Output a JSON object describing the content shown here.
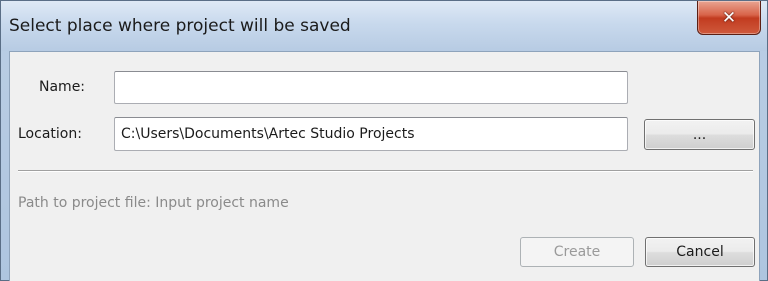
{
  "window": {
    "title": "Select place where project will be saved",
    "close_glyph": "✕"
  },
  "form": {
    "name_label": "Name:",
    "name_value": "",
    "location_label": "Location:",
    "location_value": "C:\\Users\\Documents\\Artec Studio Projects",
    "browse_label": "...",
    "path_info": "Path to project file: Input project name"
  },
  "buttons": {
    "create_label": "Create",
    "cancel_label": "Cancel"
  },
  "icons": {
    "close": "close-icon"
  },
  "colors": {
    "title_bar": "#c8d9ed",
    "close_button": "#c23b20",
    "client_background": "#f0f0f0",
    "disabled_text": "#9a9a9a"
  }
}
